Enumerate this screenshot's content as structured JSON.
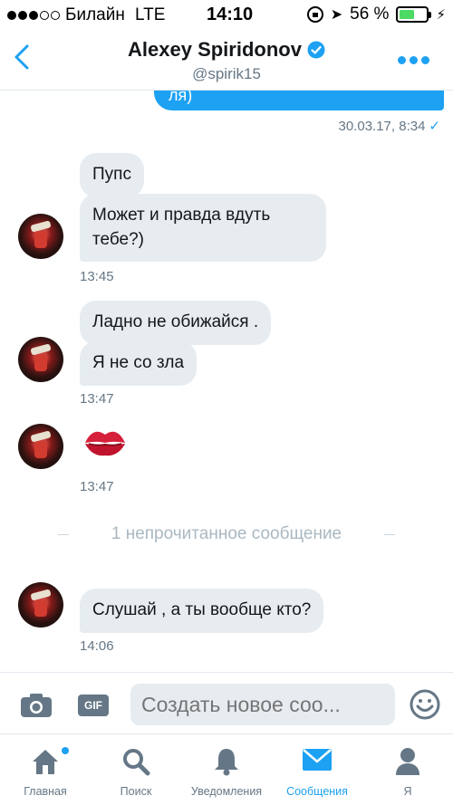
{
  "status": {
    "carrier": "Билайн",
    "network": "LTE",
    "time": "14:10",
    "battery": "56 %",
    "battery_level": 0.56
  },
  "header": {
    "name": "Alexey Spiridonov",
    "handle": "@spirik15"
  },
  "conversation": {
    "outgoing_partial": "ля)",
    "outgoing_meta": "30.03.17, 8:34",
    "outgoing_check": "✓",
    "group1": {
      "msg1": "Пупс",
      "msg2": "Может и правда вдуть тебе?)",
      "time": "13:45"
    },
    "group2": {
      "msg1": "Ладно не обижайся .",
      "msg2": "Я не со зла",
      "time": "13:47"
    },
    "group3": {
      "time": "13:47"
    },
    "unread_divider": "1 непрочитанное сообщение",
    "group4": {
      "msg1": "Слушай , а ты вообще кто?",
      "time": "14:06"
    }
  },
  "composer": {
    "gif_label": "GIF",
    "placeholder": "Создать новое соо..."
  },
  "tabs": [
    {
      "label": "Главная"
    },
    {
      "label": "Поиск"
    },
    {
      "label": "Уведомления"
    },
    {
      "label": "Сообщения"
    },
    {
      "label": "Я"
    }
  ],
  "colors": {
    "accent": "#1da1f2",
    "bubble_incoming": "#e6ecf0",
    "muted": "#657786"
  }
}
